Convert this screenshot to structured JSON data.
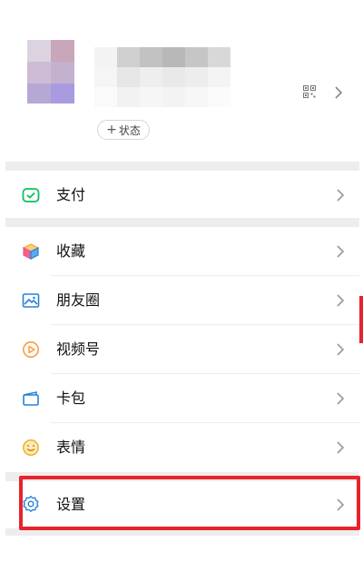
{
  "profile": {
    "status_label": "状态",
    "status_plus": "+"
  },
  "menu": {
    "pay": {
      "label": "支付",
      "icon": "wallet-check-icon"
    },
    "favorites": {
      "label": "收藏",
      "icon": "cube-icon"
    },
    "moments": {
      "label": "朋友圈",
      "icon": "image-icon"
    },
    "channels": {
      "label": "视频号",
      "icon": "play-circle-icon"
    },
    "cards": {
      "label": "卡包",
      "icon": "card-icon"
    },
    "stickers": {
      "label": "表情",
      "icon": "smile-icon"
    },
    "settings": {
      "label": "设置",
      "icon": "gear-icon"
    }
  },
  "colors": {
    "green": "#07c160",
    "orange": "#fa9d3b",
    "blue": "#2782d7",
    "highlight": "#e8232d",
    "divider": "#ededed"
  }
}
